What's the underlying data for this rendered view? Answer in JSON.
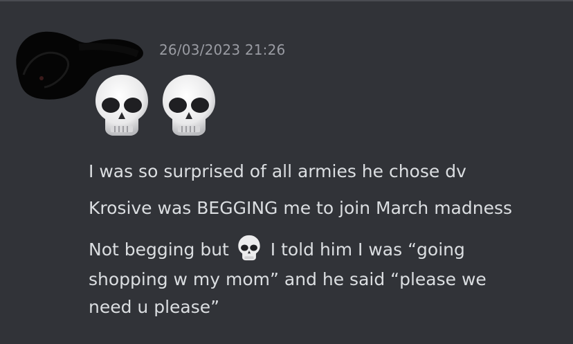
{
  "message": {
    "timestamp": "26/03/2023 21:26",
    "big_emojis": [
      "skull-emoji",
      "skull-emoji"
    ],
    "lines": [
      "I was so surprised of all armies he chose dv",
      "Krosive was BEGGING me to join March madness"
    ],
    "last_message": {
      "part1": "Not begging but",
      "part2": "I told him I was “going",
      "line2": "shopping w my mom” and he said “please we",
      "line3": "need u please”"
    }
  },
  "colors": {
    "background": "#313338",
    "text": "#dbdee1",
    "timestamp": "#9a9ca3"
  }
}
